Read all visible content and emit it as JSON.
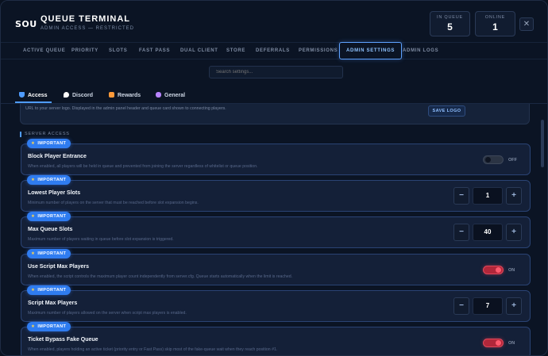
{
  "app": {
    "logo": "SOU",
    "title": "QUEUE TERMINAL",
    "subtitle": "ADMIN ACCESS — RESTRICTED",
    "stats": [
      {
        "label": "IN QUEUE",
        "value": "5"
      },
      {
        "label": "ONLINE",
        "value": "1"
      }
    ],
    "close": "✕"
  },
  "nav": {
    "items": [
      "ACTIVE QUEUE",
      "PRIORITY",
      "SLOTS",
      "FAST PASS",
      "DUAL CLIENT",
      "STORE",
      "DEFERRALS",
      "PERMISSIONS",
      "ADMIN SETTINGS",
      "ADMIN LOGS"
    ],
    "active": "ADMIN SETTINGS"
  },
  "search": {
    "placeholder": "Search settings..."
  },
  "subtabs": {
    "items": [
      {
        "label": "Access",
        "icon": "shield-icon",
        "color": "#4f9cff"
      },
      {
        "label": "Discord",
        "icon": "chat-icon",
        "color": "#ffffff"
      },
      {
        "label": "Rewards",
        "icon": "gift-icon",
        "color": "#ff9a3a"
      },
      {
        "label": "General",
        "icon": "gamepad-icon",
        "color": "#b884ff"
      }
    ],
    "active": "Access"
  },
  "logo_card": {
    "desc": "URL to your server logo. Displayed in the admin panel header and queue card shown to connecting players.",
    "button": "SAVE LOGO"
  },
  "section": {
    "title": "SERVER ACCESS"
  },
  "badge_label": "IMPORTANT",
  "settings": [
    {
      "name": "Block Player Entrance",
      "desc": "When enabled, all players will be held in queue and prevented from joining the server regardless of whitelist or queue position.",
      "control": "toggle",
      "state": "OFF"
    },
    {
      "name": "Lowest Player Slots",
      "desc": "Minimum number of players on the server that must be reached before slot expansion begins.",
      "control": "stepper",
      "value": "1"
    },
    {
      "name": "Max Queue Slots",
      "desc": "Maximum number of players waiting in queue before slot expansion is triggered.",
      "control": "stepper",
      "value": "40"
    },
    {
      "name": "Use Script Max Players",
      "desc": "When enabled, the script controls the maximum player count independently from server.cfg. Queue starts automatically when the limit is reached.",
      "control": "toggle",
      "state": "ON"
    },
    {
      "name": "Script Max Players",
      "desc": "Maximum number of players allowed on the server when script max players is enabled.",
      "control": "stepper",
      "value": "7"
    },
    {
      "name": "Ticket Bypass Fake Queue",
      "desc": "When enabled, players holding an active ticket (priority entry or Fast Pass) skip most of the fake-queue wait when they reach position #1.",
      "control": "toggle",
      "state": "ON"
    }
  ],
  "colors": {
    "accent": "#4f9cff",
    "badge": "#2f7cf0",
    "toggle_on": "#e0475a",
    "background": "#0b1424"
  }
}
